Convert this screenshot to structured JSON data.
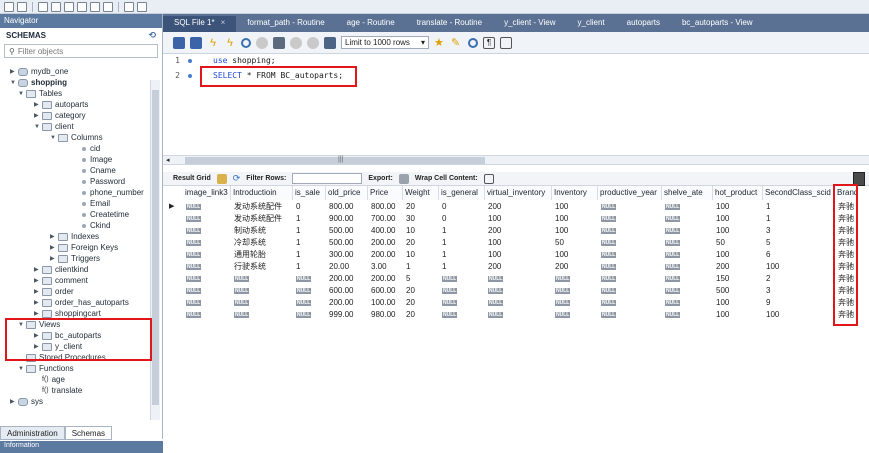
{
  "navigator": {
    "title": "Navigator",
    "schemas_label": "SCHEMAS",
    "filter_placeholder": "Filter objects",
    "tree": [
      {
        "label": "mydb_one",
        "indent": 0,
        "arrow": "▶",
        "icon": "database-icon"
      },
      {
        "label": "shopping",
        "indent": 0,
        "arrow": "▼",
        "icon": "database-icon",
        "bold": true
      },
      {
        "label": "Tables",
        "indent": 1,
        "arrow": "▼",
        "icon": "tables-folder-icon"
      },
      {
        "label": "autoparts",
        "indent": 2,
        "arrow": "▶",
        "icon": "table-icon"
      },
      {
        "label": "category",
        "indent": 2,
        "arrow": "▶",
        "icon": "table-icon"
      },
      {
        "label": "client",
        "indent": 2,
        "arrow": "▼",
        "icon": "table-icon"
      },
      {
        "label": "Columns",
        "indent": 3,
        "arrow": "▼",
        "icon": "columns-folder-icon"
      },
      {
        "label": "cid",
        "indent": 4,
        "arrow": "",
        "icon": "column-icon"
      },
      {
        "label": "Image",
        "indent": 4,
        "arrow": "",
        "icon": "column-icon"
      },
      {
        "label": "Cname",
        "indent": 4,
        "arrow": "",
        "icon": "column-icon"
      },
      {
        "label": "Password",
        "indent": 4,
        "arrow": "",
        "icon": "column-icon"
      },
      {
        "label": "phone_number",
        "indent": 4,
        "arrow": "",
        "icon": "column-icon"
      },
      {
        "label": "Email",
        "indent": 4,
        "arrow": "",
        "icon": "column-icon"
      },
      {
        "label": "Createtime",
        "indent": 4,
        "arrow": "",
        "icon": "column-icon"
      },
      {
        "label": "Ckind",
        "indent": 4,
        "arrow": "",
        "icon": "column-icon"
      },
      {
        "label": "Indexes",
        "indent": 3,
        "arrow": "▶",
        "icon": "indexes-folder-icon"
      },
      {
        "label": "Foreign Keys",
        "indent": 3,
        "arrow": "▶",
        "icon": "foreign-keys-folder-icon"
      },
      {
        "label": "Triggers",
        "indent": 3,
        "arrow": "▶",
        "icon": "triggers-folder-icon"
      },
      {
        "label": "clientkind",
        "indent": 2,
        "arrow": "▶",
        "icon": "table-icon"
      },
      {
        "label": "comment",
        "indent": 2,
        "arrow": "▶",
        "icon": "table-icon"
      },
      {
        "label": "order",
        "indent": 2,
        "arrow": "▶",
        "icon": "table-icon"
      },
      {
        "label": "order_has_autoparts",
        "indent": 2,
        "arrow": "▶",
        "icon": "table-icon"
      },
      {
        "label": "shoppingcart",
        "indent": 2,
        "arrow": "▶",
        "icon": "table-icon"
      },
      {
        "label": "Views",
        "indent": 1,
        "arrow": "▼",
        "icon": "views-folder-icon"
      },
      {
        "label": "bc_autoparts",
        "indent": 2,
        "arrow": "▶",
        "icon": "view-icon"
      },
      {
        "label": "y_client",
        "indent": 2,
        "arrow": "▶",
        "icon": "view-icon"
      },
      {
        "label": "Stored Procedures",
        "indent": 1,
        "arrow": "",
        "icon": "procedures-folder-icon"
      },
      {
        "label": "Functions",
        "indent": 1,
        "arrow": "▼",
        "icon": "functions-folder-icon"
      },
      {
        "label": "age",
        "indent": 2,
        "arrow": "",
        "icon": "function-icon"
      },
      {
        "label": "translate",
        "indent": 2,
        "arrow": "",
        "icon": "function-icon"
      },
      {
        "label": "sys",
        "indent": 0,
        "arrow": "▶",
        "icon": "database-icon"
      }
    ],
    "bottom_tabs": [
      "Administration",
      "Schemas"
    ],
    "info_label": "Information"
  },
  "editor_tabs": [
    {
      "label": "SQL File 1*",
      "active": true,
      "closable": true
    },
    {
      "label": "format_path - Routine"
    },
    {
      "label": "age - Routine"
    },
    {
      "label": "translate - Routine"
    },
    {
      "label": "y_client - View"
    },
    {
      "label": "y_client"
    },
    {
      "label": "autoparts"
    },
    {
      "label": "bc_autoparts - View"
    }
  ],
  "editor_toolbar": {
    "limit_label": "Limit to 1000 rows"
  },
  "editor": {
    "lines": [
      {
        "num": "1",
        "kw": "use",
        "rest": " shopping;"
      },
      {
        "num": "2",
        "kw": "SELECT",
        "rest": " * FROM BC_autoparts;"
      }
    ]
  },
  "result_toolbar": {
    "result_grid": "Result Grid",
    "filter_rows": "Filter Rows:",
    "export": "Export:",
    "wrap": "Wrap Cell Content:"
  },
  "grid": {
    "columns": [
      "image_link3",
      "Introductioin",
      "is_sale",
      "old_price",
      "Price",
      "Weight",
      "is_general",
      "virtual_inventory",
      "Inventory",
      "productive_year",
      "shelve_ate",
      "hot_product",
      "SecondClass_scid",
      "Brand"
    ],
    "null_text": "NULL",
    "rows": [
      [
        "NULL",
        "发动系统配件",
        "0",
        "800.00",
        "800.00",
        "20",
        "0",
        "200",
        "100",
        "NULL",
        "NULL",
        "100",
        "1",
        "奔驰"
      ],
      [
        "NULL",
        "发动系统配件",
        "1",
        "900.00",
        "700.00",
        "30",
        "0",
        "100",
        "100",
        "NULL",
        "NULL",
        "100",
        "1",
        "奔驰"
      ],
      [
        "NULL",
        "制动系统",
        "1",
        "500.00",
        "400.00",
        "10",
        "1",
        "200",
        "100",
        "NULL",
        "NULL",
        "100",
        "3",
        "奔驰"
      ],
      [
        "NULL",
        "冷却系统",
        "1",
        "500.00",
        "200.00",
        "20",
        "1",
        "100",
        "50",
        "NULL",
        "NULL",
        "50",
        "5",
        "奔驰"
      ],
      [
        "NULL",
        "通用轮胎",
        "1",
        "300.00",
        "200.00",
        "10",
        "1",
        "100",
        "100",
        "NULL",
        "NULL",
        "100",
        "6",
        "奔驰"
      ],
      [
        "NULL",
        "行驶系统",
        "1",
        "20.00",
        "3.00",
        "1",
        "1",
        "200",
        "200",
        "NULL",
        "NULL",
        "200",
        "100",
        "奔驰"
      ],
      [
        "NULL",
        "NULL",
        "NULL",
        "200.00",
        "200.00",
        "5",
        "NULL",
        "NULL",
        "NULL",
        "NULL",
        "NULL",
        "150",
        "2",
        "奔驰"
      ],
      [
        "NULL",
        "NULL",
        "NULL",
        "600.00",
        "600.00",
        "20",
        "NULL",
        "NULL",
        "NULL",
        "NULL",
        "NULL",
        "500",
        "3",
        "奔驰"
      ],
      [
        "NULL",
        "NULL",
        "NULL",
        "200.00",
        "100.00",
        "20",
        "NULL",
        "NULL",
        "NULL",
        "NULL",
        "NULL",
        "100",
        "9",
        "奔驰"
      ],
      [
        "NULL",
        "NULL",
        "NULL",
        "999.00",
        "980.00",
        "20",
        "NULL",
        "NULL",
        "NULL",
        "NULL",
        "NULL",
        "100",
        "100",
        "奔驰"
      ]
    ]
  },
  "colors": {
    "highlight": "#e0161b",
    "tabbar": "#5b7193",
    "keyword": "#1f4ad8"
  }
}
